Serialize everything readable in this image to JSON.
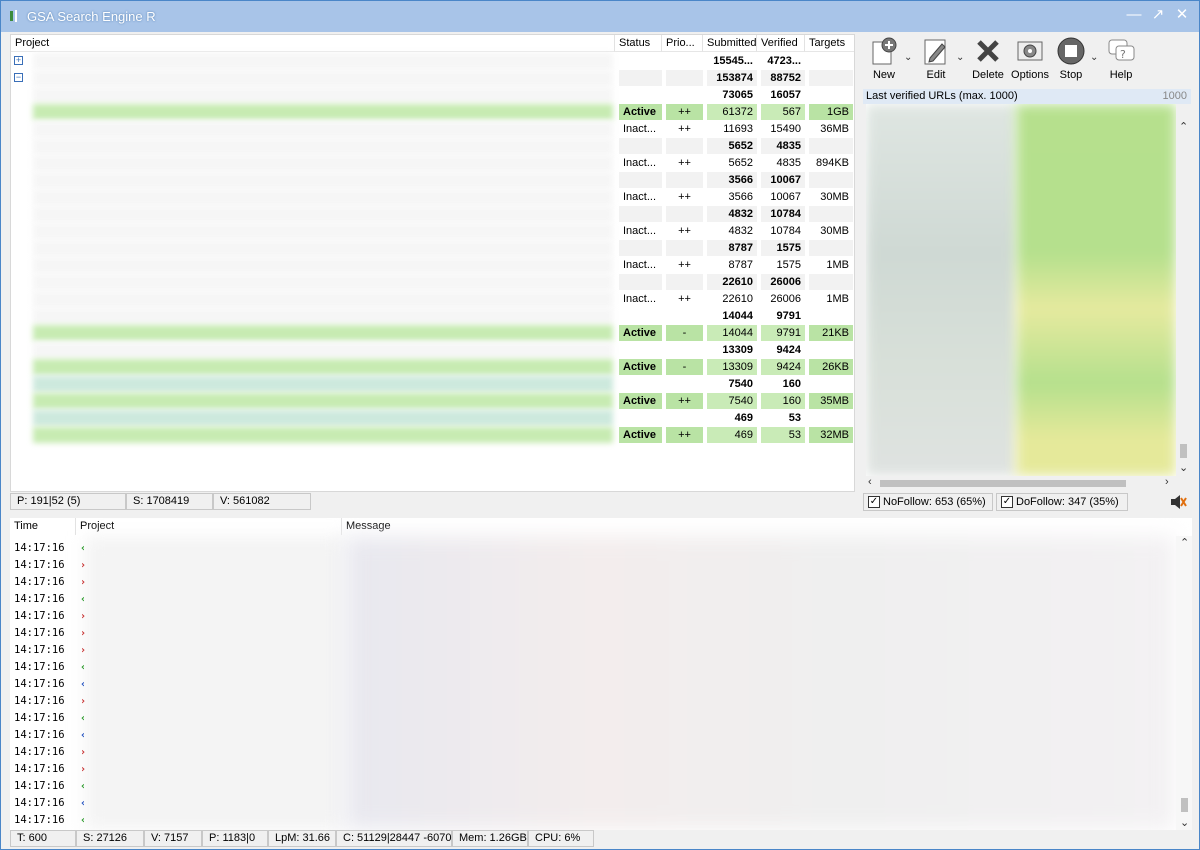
{
  "window": {
    "title": "GSA Search Engine R"
  },
  "projects": {
    "columns": [
      "Project",
      "Status",
      "Prio...",
      "Submitted",
      "Verified",
      "Targets"
    ],
    "rows": [
      {
        "status": "",
        "prio": "",
        "submitted": "15545...",
        "verified": "4723...",
        "targets": "",
        "bold": true,
        "bg": "white"
      },
      {
        "status": "",
        "prio": "",
        "submitted": "153874",
        "verified": "88752",
        "targets": "",
        "bold": true,
        "bg": "grey"
      },
      {
        "status": "",
        "prio": "",
        "submitted": "73065",
        "verified": "16057",
        "targets": "",
        "bold": true,
        "bg": "white"
      },
      {
        "status": "Active",
        "prio": "++",
        "submitted": "61372",
        "verified": "567",
        "targets": "1GB",
        "bold": false,
        "bg": "active"
      },
      {
        "status": "Inact...",
        "prio": "++",
        "submitted": "11693",
        "verified": "15490",
        "targets": "36MB",
        "bold": false,
        "bg": "white"
      },
      {
        "status": "",
        "prio": "",
        "submitted": "5652",
        "verified": "4835",
        "targets": "",
        "bold": true,
        "bg": "grey"
      },
      {
        "status": "Inact...",
        "prio": "++",
        "submitted": "5652",
        "verified": "4835",
        "targets": "894KB",
        "bold": false,
        "bg": "white"
      },
      {
        "status": "",
        "prio": "",
        "submitted": "3566",
        "verified": "10067",
        "targets": "",
        "bold": true,
        "bg": "grey"
      },
      {
        "status": "Inact...",
        "prio": "++",
        "submitted": "3566",
        "verified": "10067",
        "targets": "30MB",
        "bold": false,
        "bg": "white"
      },
      {
        "status": "",
        "prio": "",
        "submitted": "4832",
        "verified": "10784",
        "targets": "",
        "bold": true,
        "bg": "grey"
      },
      {
        "status": "Inact...",
        "prio": "++",
        "submitted": "4832",
        "verified": "10784",
        "targets": "30MB",
        "bold": false,
        "bg": "white"
      },
      {
        "status": "",
        "prio": "",
        "submitted": "8787",
        "verified": "1575",
        "targets": "",
        "bold": true,
        "bg": "grey"
      },
      {
        "status": "Inact...",
        "prio": "++",
        "submitted": "8787",
        "verified": "1575",
        "targets": "1MB",
        "bold": false,
        "bg": "white"
      },
      {
        "status": "",
        "prio": "",
        "submitted": "22610",
        "verified": "26006",
        "targets": "",
        "bold": true,
        "bg": "grey"
      },
      {
        "status": "Inact...",
        "prio": "++",
        "submitted": "22610",
        "verified": "26006",
        "targets": "1MB",
        "bold": false,
        "bg": "white"
      },
      {
        "status": "",
        "prio": "",
        "submitted": "14044",
        "verified": "9791",
        "targets": "",
        "bold": true,
        "bg": "white"
      },
      {
        "status": "Active",
        "prio": "-",
        "submitted": "14044",
        "verified": "9791",
        "targets": "21KB",
        "bold": false,
        "bg": "active"
      },
      {
        "status": "",
        "prio": "",
        "submitted": "13309",
        "verified": "9424",
        "targets": "",
        "bold": true,
        "bg": "white"
      },
      {
        "status": "Active",
        "prio": "-",
        "submitted": "13309",
        "verified": "9424",
        "targets": "26KB",
        "bold": false,
        "bg": "active"
      },
      {
        "status": "",
        "prio": "",
        "submitted": "7540",
        "verified": "160",
        "targets": "",
        "bold": true,
        "bg": "white"
      },
      {
        "status": "Active",
        "prio": "++",
        "submitted": "7540",
        "verified": "160",
        "targets": "35MB",
        "bold": false,
        "bg": "active"
      },
      {
        "status": "",
        "prio": "",
        "submitted": "469",
        "verified": "53",
        "targets": "",
        "bold": true,
        "bg": "white"
      },
      {
        "status": "Active",
        "prio": "++",
        "submitted": "469",
        "verified": "53",
        "targets": "32MB",
        "bold": false,
        "bg": "active"
      }
    ]
  },
  "toolbar": {
    "new": "New",
    "edit": "Edit",
    "delete": "Delete",
    "options": "Options",
    "stop": "Stop",
    "help": "Help"
  },
  "verified_panel": {
    "title": "Last verified URLs (max. 1000)",
    "count": "1000"
  },
  "follow": {
    "nofollow": "NoFollow: 653 (65%)",
    "dofollow": "DoFollow: 347 (35%)"
  },
  "status_top": {
    "p": "P: 191|52 (5)",
    "s": "S: 1708419",
    "v": "V: 561082"
  },
  "log": {
    "columns": [
      "Time",
      "Project",
      "Message"
    ],
    "rows": [
      {
        "time": "14:17:16",
        "mark": "‹",
        "color": "#2a9a2a"
      },
      {
        "time": "14:17:16",
        "mark": "›",
        "color": "#c83232"
      },
      {
        "time": "14:17:16",
        "mark": "›",
        "color": "#c83232"
      },
      {
        "time": "14:17:16",
        "mark": "‹",
        "color": "#2a9a2a"
      },
      {
        "time": "14:17:16",
        "mark": "›",
        "color": "#c83232"
      },
      {
        "time": "14:17:16",
        "mark": "›",
        "color": "#c83232"
      },
      {
        "time": "14:17:16",
        "mark": "›",
        "color": "#c83232"
      },
      {
        "time": "14:17:16",
        "mark": "‹",
        "color": "#2a9a2a"
      },
      {
        "time": "14:17:16",
        "mark": "‹",
        "color": "#2050c0"
      },
      {
        "time": "14:17:16",
        "mark": "›",
        "color": "#c83232"
      },
      {
        "time": "14:17:16",
        "mark": "‹",
        "color": "#2a9a2a"
      },
      {
        "time": "14:17:16",
        "mark": "‹",
        "color": "#2050c0"
      },
      {
        "time": "14:17:16",
        "mark": "›",
        "color": "#c83232"
      },
      {
        "time": "14:17:16",
        "mark": "›",
        "color": "#c83232"
      },
      {
        "time": "14:17:16",
        "mark": "‹",
        "color": "#2a9a2a"
      },
      {
        "time": "14:17:16",
        "mark": "‹",
        "color": "#2050c0"
      },
      {
        "time": "14:17:16",
        "mark": "‹",
        "color": "#2a9a2a"
      }
    ]
  },
  "status_bottom": {
    "t": "T: 600",
    "s": "S: 27126",
    "v": "V: 7157",
    "p": "P: 1183|0",
    "lpm": "LpM: 31.66",
    "c": "C: 51129|28447 -6070",
    "mem": "Mem: 1.26GB",
    "cpu": "CPU: 6%"
  }
}
